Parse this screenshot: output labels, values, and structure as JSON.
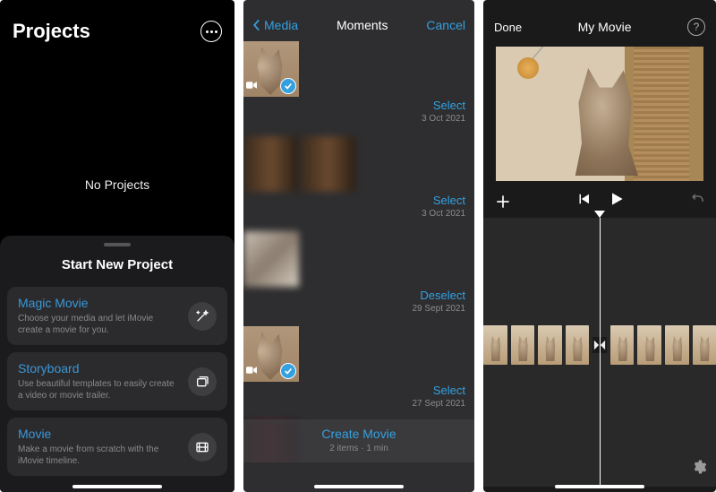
{
  "phone1": {
    "title": "Projects",
    "empty_label": "No Projects",
    "sheet_title": "Start New Project",
    "options": [
      {
        "title": "Magic Movie",
        "desc": "Choose your media and let iMovie create a movie for you."
      },
      {
        "title": "Storyboard",
        "desc": "Use beautiful templates to easily create a video or movie trailer."
      },
      {
        "title": "Movie",
        "desc": "Make a movie from scratch with the iMovie timeline."
      }
    ]
  },
  "phone2": {
    "back_label": "Media",
    "title": "Moments",
    "cancel_label": "Cancel",
    "moments": [
      {
        "select_label": "Select",
        "date": "3 Oct 2021"
      },
      {
        "select_label": "Select",
        "date": "3 Oct 2021"
      },
      {
        "select_label": "Deselect",
        "date": "29 Sept 2021"
      },
      {
        "select_label": "Select",
        "date": "27 Sept 2021"
      }
    ],
    "create_label": "Create Movie",
    "create_sub": "2 items · 1 min"
  },
  "phone3": {
    "done_label": "Done",
    "title": "My Movie"
  }
}
